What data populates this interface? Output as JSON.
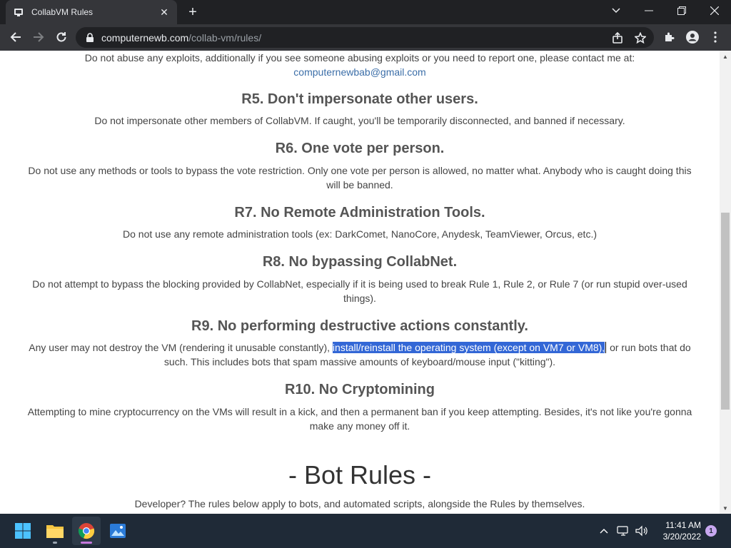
{
  "browser": {
    "tab_title": "CollabVM Rules",
    "tab_close": "✕",
    "new_tab": "+",
    "url_host": "computernewb.com",
    "url_path": "/collab-vm/rules/"
  },
  "page": {
    "r4_text": "Do not abuse any exploits, additionally if you see someone abusing exploits or you need to report one, please contact me at:",
    "r4_email": "computernewbab@gmail.com",
    "r5_heading": "R5. Don't impersonate other users.",
    "r5_text": "Do not impersonate other members of CollabVM. If caught, you'll be temporarily disconnected, and banned if necessary.",
    "r6_heading": "R6. One vote per person.",
    "r6_text": "Do not use any methods or tools to bypass the vote restriction. Only one vote per person is allowed, no matter what. Anybody who is caught doing this will be banned.",
    "r7_heading": "R7. No Remote Administration Tools.",
    "r7_text": "Do not use any remote administration tools (ex: DarkComet, NanoCore, Anydesk, TeamViewer, Orcus, etc.)",
    "r8_heading": "R8. No bypassing CollabNet.",
    "r8_text": "Do not attempt to bypass the blocking provided by CollabNet, especially if it is being used to break Rule 1, Rule 2, or Rule 7 (or run stupid over-used things).",
    "r9_heading": "R9. No performing destructive actions constantly.",
    "r9_text_before": "Any user may not destroy the VM (rendering it unusable constantly), ",
    "r9_text_selected": "install/reinstall the operating system (except on VM7 or VM8),",
    "r9_text_after": " or run bots that do such. This includes bots that spam massive amounts of keyboard/mouse input (\"kitting\").",
    "r10_heading": "R10. No Cryptomining",
    "r10_text": "Attempting to mine cryptocurrency on the VMs will result in a kick, and then a permanent ban if you keep attempting. Besides, it's not like you're gonna make any money off it.",
    "bot_rules_title": "- Bot Rules -",
    "bot_rules_text": "Developer? The rules below apply to bots, and automated scripts, alongside the Rules by themselves."
  },
  "taskbar": {
    "time": "11:41 AM",
    "date": "3/20/2022",
    "notification_count": "1",
    "apps": [
      "start-icon",
      "file-explorer-icon",
      "chrome-icon",
      "photos-icon"
    ]
  },
  "colors": {
    "selection": "#3367d6",
    "link": "#3b6ea8",
    "taskbar": "#1f2a37",
    "chrome_dark": "#202124"
  }
}
